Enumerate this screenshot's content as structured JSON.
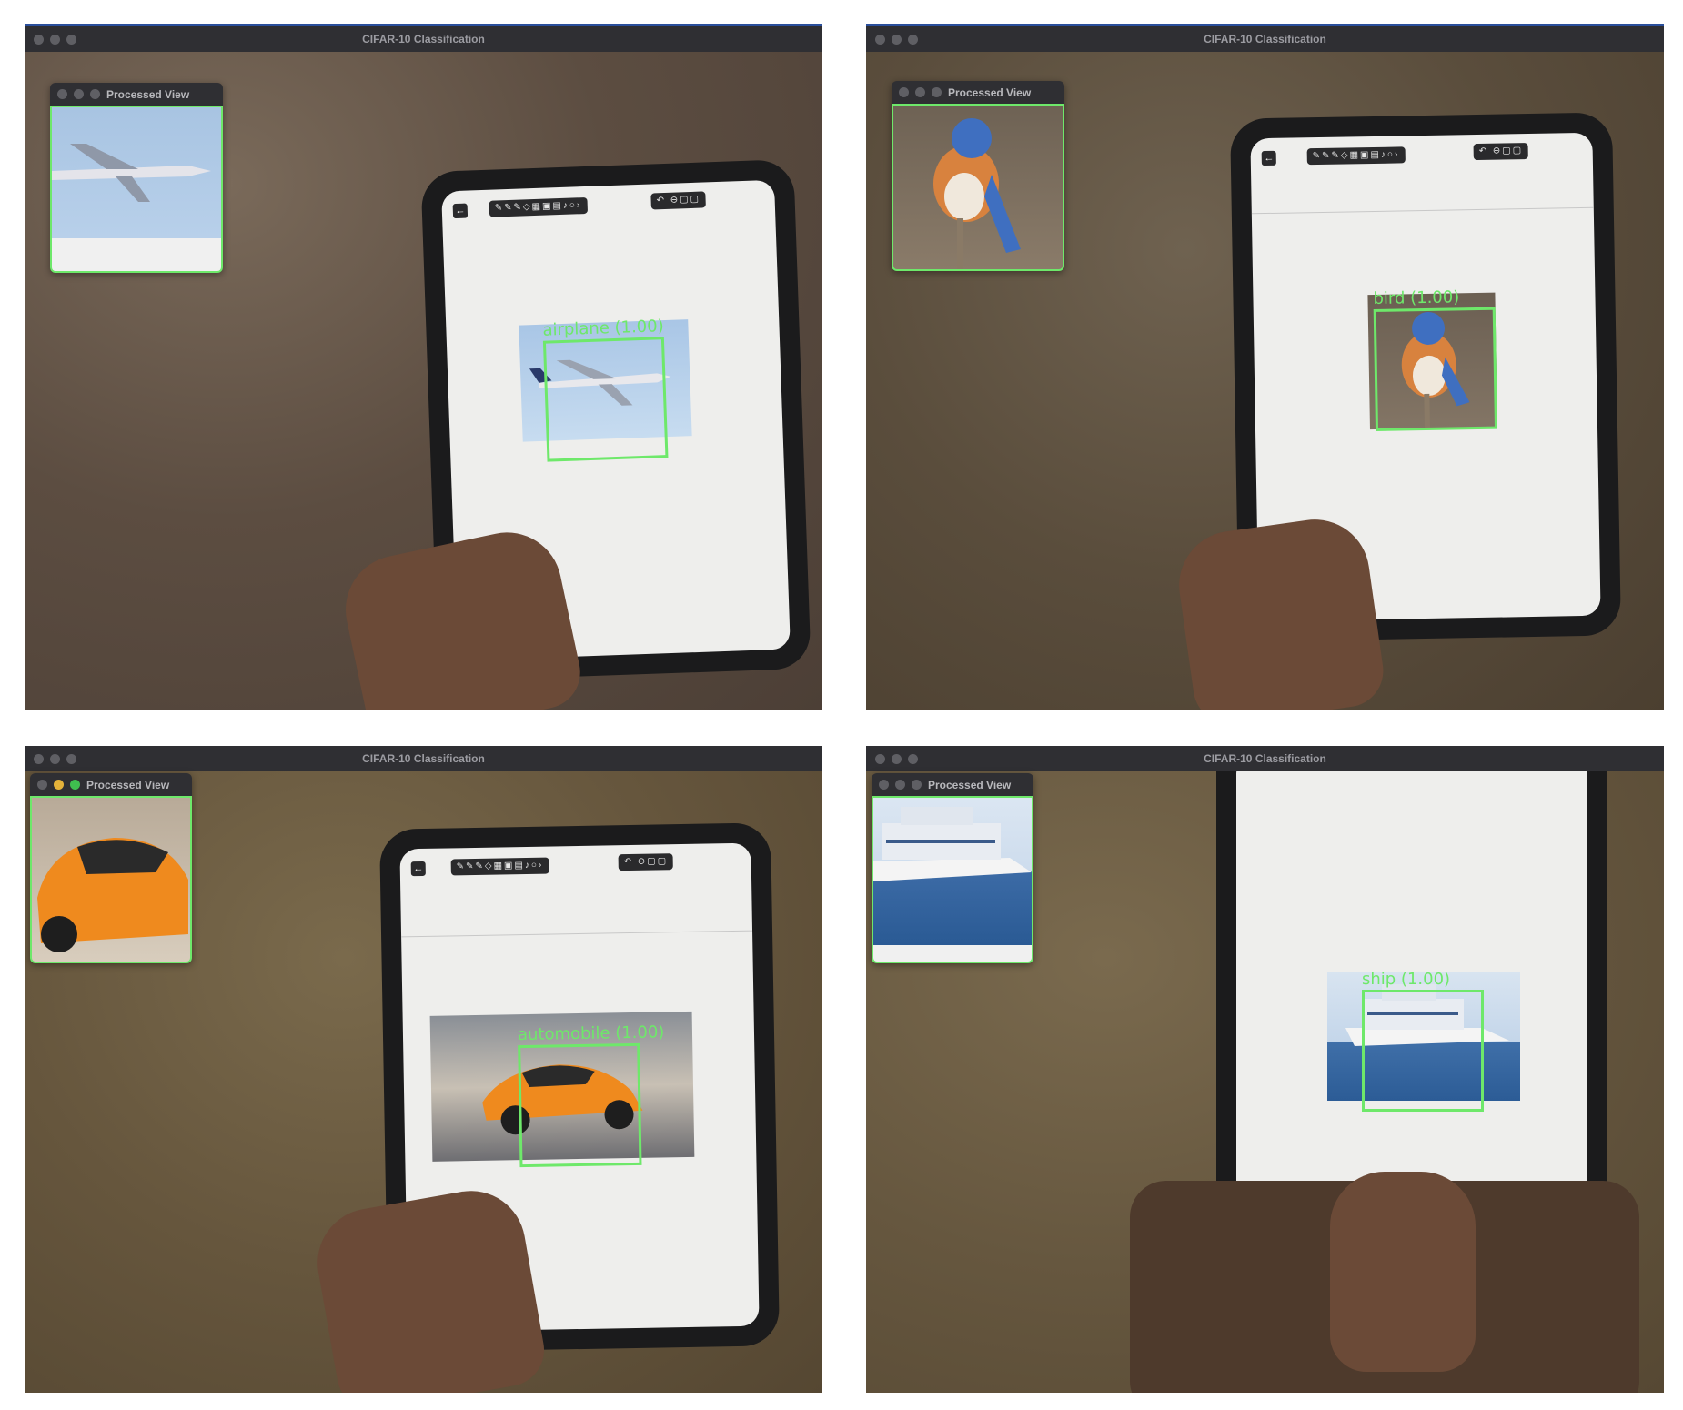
{
  "panels": [
    {
      "window_title": "CIFAR-10 Classification",
      "processed_view_title": "Processed View",
      "prediction": "airplane (1.00)",
      "subject": "airplane"
    },
    {
      "window_title": "CIFAR-10 Classification",
      "processed_view_title": "Processed View",
      "prediction": "bird (1.00)",
      "subject": "bird"
    },
    {
      "window_title": "CIFAR-10 Classification",
      "processed_view_title": "Processed View",
      "prediction": "automobile (1.00)",
      "subject": "automobile"
    },
    {
      "window_title": "CIFAR-10 Classification",
      "processed_view_title": "Processed View",
      "prediction": "ship (1.00)",
      "subject": "ship"
    }
  ],
  "colors": {
    "detection_box": "#6ee86a",
    "titlebar": "#2f2f33",
    "traffic_light_yellow": "#e4b23a",
    "traffic_light_green": "#3fbf4f"
  },
  "icons": [
    "back-arrow-icon",
    "drawing-tools-icon",
    "undo-icon",
    "zoom-icon",
    "copy-icon"
  ]
}
